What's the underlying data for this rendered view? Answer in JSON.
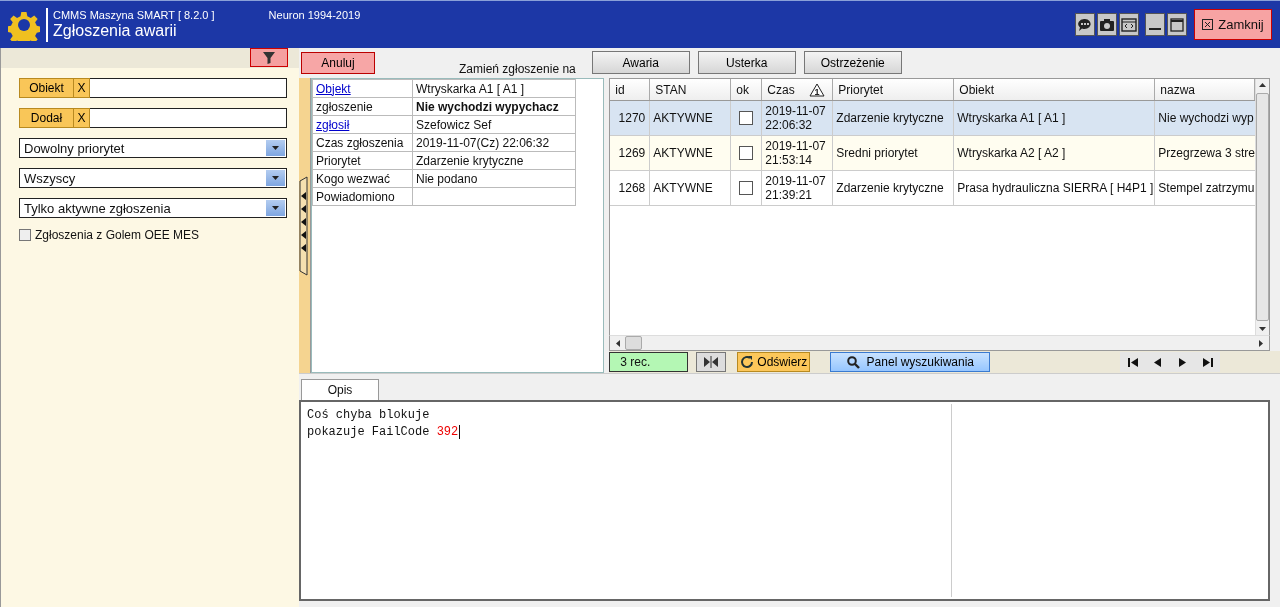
{
  "window": {
    "app_name": "CMMS Maszyna SMART  [ 8.2.0 ]",
    "copyright": "Neuron 1994-2019",
    "title": "Zgłoszenia awarii",
    "close_label": "Zamknij"
  },
  "filters": {
    "pickers": [
      {
        "label": "Obiekt",
        "clear": "X"
      },
      {
        "label": "Dodał",
        "clear": "X"
      }
    ],
    "dropdowns": [
      "Dowolny priorytet",
      "Wszyscy",
      "Tylko aktywne zgłoszenia"
    ],
    "checkbox": {
      "label": "Zgłoszenia z Golem OEE MES",
      "checked": false
    }
  },
  "toolbar": {
    "cancel": "Anuluj",
    "convert_label": "Zamień zgłoszenie na",
    "convert_buttons": [
      "Awaria",
      "Usterka",
      "Ostrzeżenie"
    ]
  },
  "details": [
    {
      "label": "Objekt",
      "kind": "link",
      "value": "Wtryskarka A1 [ A1 ]",
      "bold": false
    },
    {
      "label": "zgłoszenie",
      "kind": "plain",
      "value": "Nie wychodzi wypychacz",
      "bold": true
    },
    {
      "label": "zgłosił",
      "kind": "link",
      "value": "Szefowicz Sef",
      "bold": false
    },
    {
      "label": "Czas zgłoszenia",
      "kind": "plain",
      "value": "2019-11-07(Cz) 22:06:32",
      "bold": false
    },
    {
      "label": "Priorytet",
      "kind": "plain",
      "value": "Zdarzenie krytyczne",
      "bold": false
    },
    {
      "label": "Kogo wezwać",
      "kind": "plain",
      "value": "Nie podano",
      "bold": false
    },
    {
      "label": "Powiadomiono",
      "kind": "plain"
    }
  ],
  "table": {
    "columns": [
      {
        "label": "id"
      },
      {
        "label": "STAN"
      },
      {
        "label": "ok"
      },
      {
        "label": "Czas",
        "sort": "1"
      },
      {
        "label": "Priorytet"
      },
      {
        "label": "Obiekt"
      },
      {
        "label": "nazwa"
      }
    ],
    "rows": [
      {
        "id": "1270",
        "stan": "AKTYWNE",
        "ok": false,
        "date": "2019-11-07",
        "time": "22:06:32",
        "priority": "Zdarzenie krytyczne",
        "object": "Wtryskarka A1 [ A1 ]",
        "name": "Nie wychodzi wyp",
        "selected": true
      },
      {
        "id": "1269",
        "stan": "AKTYWNE",
        "ok": false,
        "date": "2019-11-07",
        "time": "21:53:14",
        "priority": "Sredni priorytet",
        "object": "Wtryskarka A2 [ A2 ]",
        "name": "Przegrzewa 3 stre",
        "selected": false
      },
      {
        "id": "1268",
        "stan": "AKTYWNE",
        "ok": false,
        "date": "2019-11-07",
        "time": "21:39:21",
        "priority": "Zdarzenie krytyczne",
        "object": "Prasa hydrauliczna SIERRA [ H4P1 ]",
        "name": "Stempel zatrzymu",
        "selected": false
      }
    ]
  },
  "status_bar": {
    "records": "3 rec.",
    "refresh": "Odświerz",
    "search_panel": "Panel wyszukiwania"
  },
  "tabs": [
    {
      "label": "Opis",
      "selected": true
    }
  ],
  "description": [
    [
      {
        "text": "Coś chyba blokuje",
        "kind": "plain"
      }
    ],
    [
      {
        "text": "pokazuje FailCode ",
        "kind": "plain"
      },
      {
        "text": "392",
        "kind": "number"
      }
    ]
  ]
}
